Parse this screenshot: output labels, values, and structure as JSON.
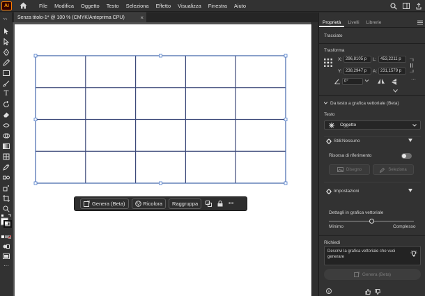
{
  "app": {
    "logo": "Ai",
    "menu": [
      "File",
      "Modifica",
      "Oggetto",
      "Testo",
      "Seleziona",
      "Effetto",
      "Visualizza",
      "Finestra",
      "Aiuto"
    ]
  },
  "document": {
    "tab_title": "Senza titolo-1* @ 100 % (CMYK/Anteprima CPU)",
    "tab_close": "×"
  },
  "grid": {
    "rows": 4,
    "cols": 5,
    "line_color": "#3d4a7a",
    "selection_color": "#4a78c8"
  },
  "contextbar": {
    "genera_label": "Genera (Beta)",
    "ricolora_label": "Ricolora",
    "raggruppa_label": "Raggruppa",
    "more": "•••"
  },
  "panel": {
    "tabs": [
      "Proprietà",
      "Livelli",
      "Librerie"
    ],
    "active_tab": "Proprietà",
    "section_tracciato": "Tracciato",
    "section_trasforma": "Trasforma",
    "transform": {
      "x_label": "X:",
      "x_value": "296,8105 p",
      "y_label": "Y:",
      "y_value": "238,2947 p",
      "l_label": "L:",
      "l_value": "453,2211 p",
      "a_label": "A:",
      "a_value": "231,1579 p",
      "angle_value": "0°"
    },
    "beta_section": "Da testo a grafica vettoriale (Beta)",
    "testo_label": "Testo",
    "testo_value": "Oggetto",
    "stili_label": "Stili:",
    "stili_value": "Nessuno",
    "risorsa_label": "Risorsa di riferimento",
    "disegno_label": "Disegno",
    "seleziona_label": "Seleziona",
    "impostazioni_label": "Impostazioni",
    "dettagli_label": "Dettagli in grafica vettoriale",
    "slider_min": "Minimo",
    "slider_max": "Complesso",
    "slider_level": 0.5,
    "richiedi_label": "Richiedi",
    "prompt_placeholder": "Descrivi la grafica vettoriale che vuoi generare",
    "genera_button": "Genera (Beta)"
  }
}
